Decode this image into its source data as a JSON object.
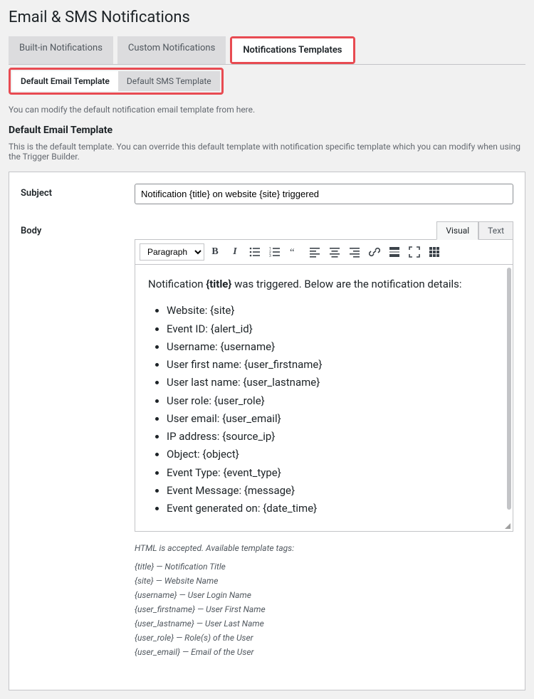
{
  "page_title": "Email & SMS Notifications",
  "main_tabs": {
    "builtin": "Built-in Notifications",
    "custom": "Custom Notifications",
    "templates": "Notifications Templates"
  },
  "sub_tabs": {
    "email": "Default Email Template",
    "sms": "Default SMS Template"
  },
  "helper_text": "You can modify the default notification email template from here.",
  "section_title": "Default Email Template",
  "section_desc": "This is the default template. You can override this default template with notification specific template which you can modify when using the Trigger Builder.",
  "labels": {
    "subject": "Subject",
    "body": "Body"
  },
  "subject_value": "Notification {title} on website {site} triggered",
  "editor_tabs": {
    "visual": "Visual",
    "text": "Text"
  },
  "toolbar": {
    "format": "Paragraph"
  },
  "body_intro_prefix": "Notification ",
  "body_intro_bold": "{title}",
  "body_intro_suffix": " was triggered. Below are the notification details:",
  "body_items": [
    "Website: {site}",
    "Event ID: {alert_id}",
    "Username: {username}",
    "User first name: {user_firstname}",
    "User last name: {user_lastname}",
    "User role: {user_role}",
    "User email: {user_email}",
    "IP address: {source_ip}",
    "Object: {object}",
    "Event Type: {event_type}",
    "Event Message: {message}",
    "Event generated on: {date_time}"
  ],
  "help_note": "HTML is accepted. Available template tags:",
  "tags": [
    "{title} — Notification Title",
    "{site} — Website Name",
    "{username} — User Login Name",
    "{user_firstname} — User First Name",
    "{user_lastname} — User Last Name",
    "{user_role} — Role(s) of the User",
    "{user_email} — Email of the User"
  ]
}
